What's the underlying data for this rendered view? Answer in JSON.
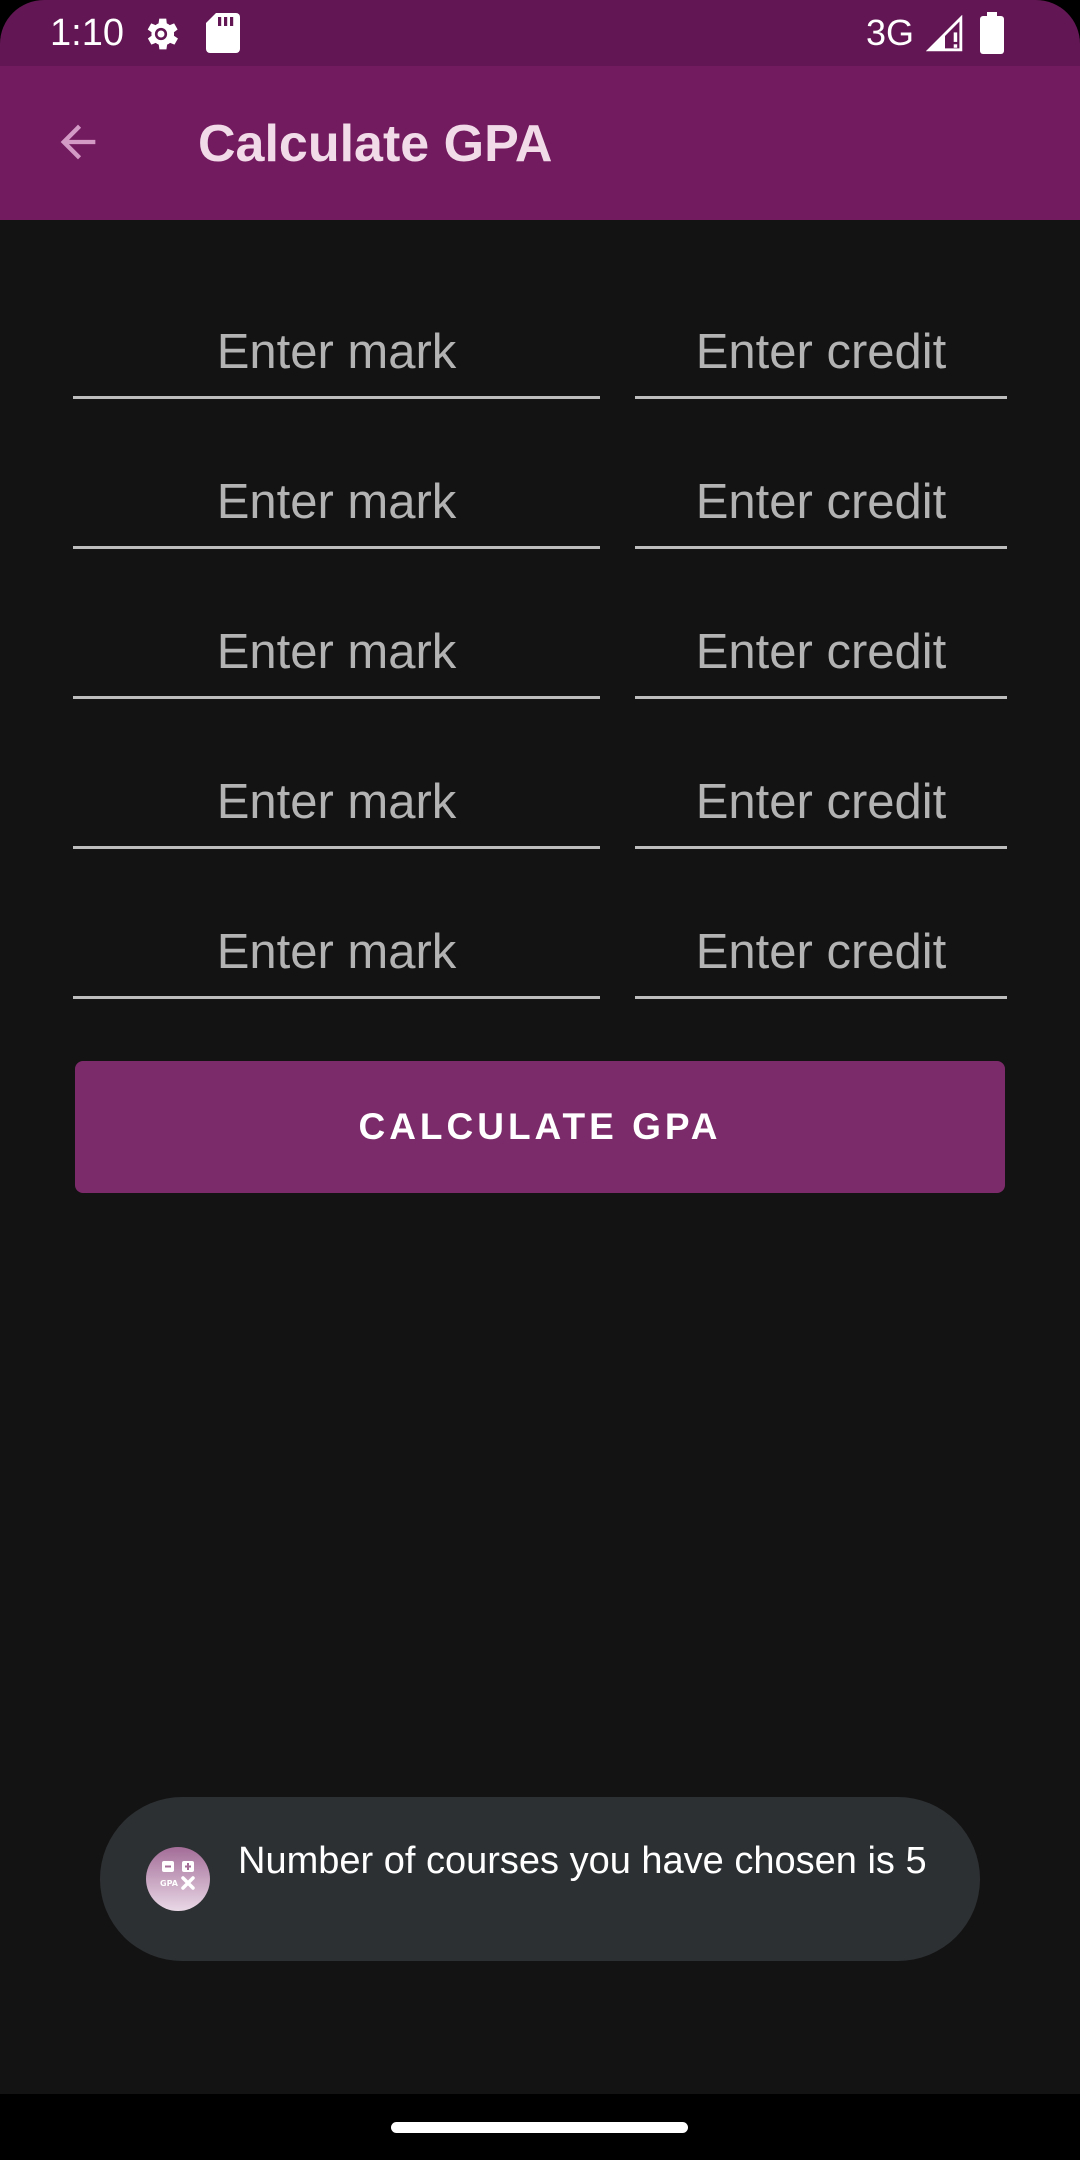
{
  "status_bar": {
    "time": "1:10",
    "network": "3G",
    "icons": [
      "settings-gear-icon",
      "sd-card-icon",
      "signal-icon",
      "battery-icon"
    ]
  },
  "app_bar": {
    "title": "Calculate GPA",
    "back_icon": "arrow-back-icon"
  },
  "form": {
    "rows": [
      {
        "mark_placeholder": "Enter mark",
        "credit_placeholder": "Enter credit"
      },
      {
        "mark_placeholder": "Enter mark",
        "credit_placeholder": "Enter credit"
      },
      {
        "mark_placeholder": "Enter mark",
        "credit_placeholder": "Enter credit"
      },
      {
        "mark_placeholder": "Enter mark",
        "credit_placeholder": "Enter credit"
      },
      {
        "mark_placeholder": "Enter mark",
        "credit_placeholder": "Enter credit"
      }
    ],
    "button_label": "CALCULATE GPA"
  },
  "toast": {
    "app_icon": "gpa-calculator-app-icon",
    "message": "Number of courses you have chosen is 5"
  },
  "colors": {
    "status_bar": "#621653",
    "app_bar": "#731b5f",
    "background": "#131313",
    "button": "#7c2b6a",
    "toast": "#2d3033"
  }
}
